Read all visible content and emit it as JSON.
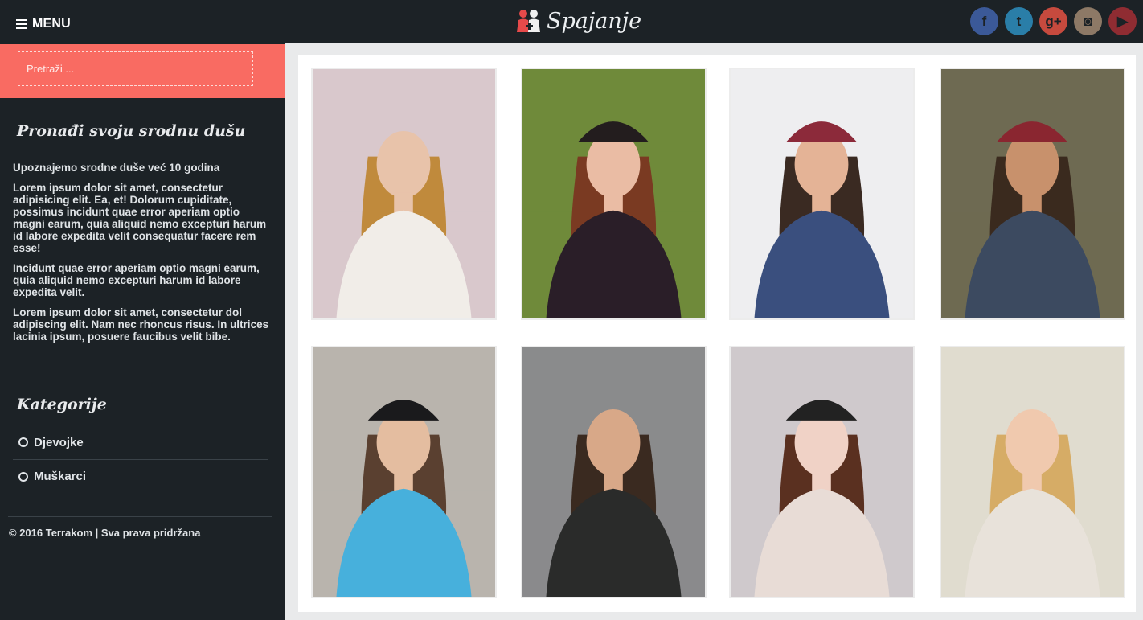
{
  "header": {
    "menu_label": "MENU",
    "logo_text": "Spajanje",
    "social": [
      {
        "name": "facebook",
        "glyph": "f",
        "color": "#3b5998"
      },
      {
        "name": "twitter",
        "glyph": "t",
        "color": "#2a7ea8"
      },
      {
        "name": "google-plus",
        "glyph": "g+",
        "color": "#c64a3e"
      },
      {
        "name": "instagram",
        "glyph": "◙",
        "color": "#8d7966"
      },
      {
        "name": "youtube",
        "glyph": "▶",
        "color": "#8f2c32"
      }
    ]
  },
  "sidebar": {
    "search_placeholder": "Pretraži ...",
    "find_heading": "Pronađi svoju srodnu dušu",
    "intro": "Upoznajemo srodne duše već 10 godina",
    "para1": "Lorem ipsum dolor sit amet, consectetur adipisicing elit. Ea, et! Dolorum cupiditate, possimus incidunt quae error aperiam optio magni earum, quia aliquid nemo excepturi harum id labore expedita velit consequatur facere rem esse!",
    "para2": "Incidunt quae error aperiam optio magni earum, quia aliquid nemo excepturi harum id labore expedita velit.",
    "para3": "Lorem ipsum dolor sit amet, consectetur dol adipiscing elit. Nam nec rhoncus risus. In ultrices lacinia ipsum, posuere faucibus velit bibe.",
    "categories_heading": "Kategorije",
    "categories": [
      "Djevojke",
      "Muškarci"
    ],
    "copyright": "© 2016 Terrakom | Sva prava pridržana"
  },
  "gallery": {
    "photos": [
      {
        "name": "photo-woman-laptop",
        "bg": "#d9c8cc",
        "skin": "#e8c3aa",
        "hair": "#c08a3c",
        "shirt": "#f1ede8",
        "hat": ""
      },
      {
        "name": "photo-woman-hat",
        "bg": "#6f8a3a",
        "skin": "#eabca4",
        "hair": "#7a3a22",
        "shirt": "#2a1e28",
        "hat": "#231d1e"
      },
      {
        "name": "photo-man-beanie",
        "bg": "#eeeef0",
        "skin": "#e4b396",
        "hair": "#3a2a22",
        "shirt": "#3a4f7e",
        "hat": "#8c2a3a"
      },
      {
        "name": "photo-man-guitar",
        "bg": "#6e6a52",
        "skin": "#c8916c",
        "hair": "#3a2a1e",
        "shirt": "#3c4a60",
        "hat": "#8a2630"
      },
      {
        "name": "photo-man-blue-shirt",
        "bg": "#b9b4ad",
        "skin": "#e4bda0",
        "hair": "#5a4030",
        "shirt": "#47b0dc",
        "hat": "#1a1a1c"
      },
      {
        "name": "photo-man-suit",
        "bg": "#8a8b8c",
        "skin": "#d8a888",
        "hair": "#3a2a20",
        "shirt": "#2a2b2a",
        "hat": ""
      },
      {
        "name": "photo-woman-headphones",
        "bg": "#cfc9cc",
        "skin": "#f0d2c6",
        "hair": "#5a3020",
        "shirt": "#e8dcd6",
        "hat": "#222222"
      },
      {
        "name": "photo-woman-smile",
        "bg": "#e0dccf",
        "skin": "#f0c9ae",
        "hair": "#d6ac66",
        "shirt": "#e8e2da",
        "hat": ""
      }
    ]
  }
}
